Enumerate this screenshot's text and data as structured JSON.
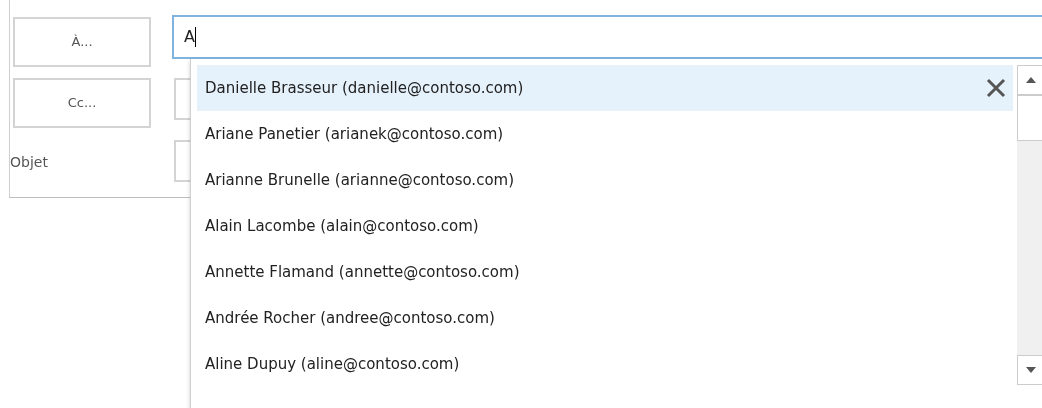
{
  "buttons": [
    {
      "label": "À..."
    },
    {
      "label": "Cc..."
    }
  ],
  "subject_label": "Objet",
  "to_field": {
    "value": "A"
  },
  "suggestions": [
    {
      "label": "Danielle Brasseur (danielle@contoso.com)",
      "selected": true
    },
    {
      "label": "Ariane Panetier (arianek@contoso.com)",
      "selected": false
    },
    {
      "label": "Arianne Brunelle (arianne@contoso.com)",
      "selected": false
    },
    {
      "label": "Alain Lacombe (alain@contoso.com)",
      "selected": false
    },
    {
      "label": "Annette Flamand (annette@contoso.com)",
      "selected": false
    },
    {
      "label": "Andrée Rocher (andree@contoso.com)",
      "selected": false
    },
    {
      "label": "Aline Dupuy (aline@contoso.com)",
      "selected": false
    }
  ]
}
